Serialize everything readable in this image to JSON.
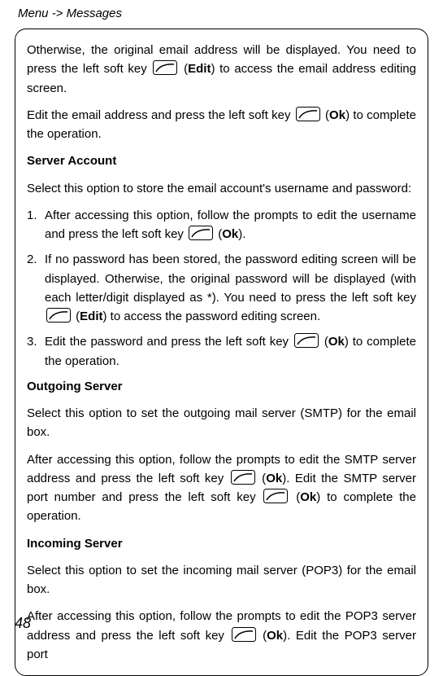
{
  "breadcrumb": "Menu -> Messages",
  "pageNumber": "48",
  "p1a": "Otherwise, the original email address will be displayed. You need to press the left soft key ",
  "p1b": " (",
  "p1c": "Edit",
  "p1d": ") to access the email address editing screen.",
  "p2a": "Edit the email address and press the left soft key ",
  "p2b": " (",
  "p2c": "Ok",
  "p2d": ") to complete the operation.",
  "h1": "Server Account",
  "p3": "Select this option to store the email account's username and password:",
  "li1num": "1.",
  "li1a": "After accessing this option, follow the prompts to edit the username and press the left soft key ",
  "li1b": " (",
  "li1c": "Ok",
  "li1d": ").",
  "li2num": "2.",
  "li2a": "If no password has been stored, the password editing screen will be displayed. Otherwise, the original password will be displayed (with each letter/digit displayed as *). You need to press the left soft key ",
  "li2b": " (",
  "li2c": "Edit",
  "li2d": ") to access the password editing screen.",
  "li3num": "3.",
  "li3a": "Edit the password and press the left soft key ",
  "li3b": " (",
  "li3c": "Ok",
  "li3d": ") to complete the operation.",
  "h2": "Outgoing Server",
  "p4": "Select this option to set the outgoing mail server (SMTP) for the email box.",
  "p5a": "After accessing this option, follow the prompts to edit the SMTP server address and press the left soft key ",
  "p5b": " (",
  "p5c": "Ok",
  "p5d": "). Edit the SMTP server port number and press the left soft key ",
  "p5e": " (",
  "p5f": "Ok",
  "p5g": ") to complete the operation.",
  "h3": "Incoming Server",
  "p6": "Select this option to set the incoming mail server (POP3) for the email box.",
  "p7a": "After accessing this option, follow the prompts to edit the POP3 server address and press the left soft key ",
  "p7b": " (",
  "p7c": "Ok",
  "p7d": "). Edit the POP3 server port"
}
